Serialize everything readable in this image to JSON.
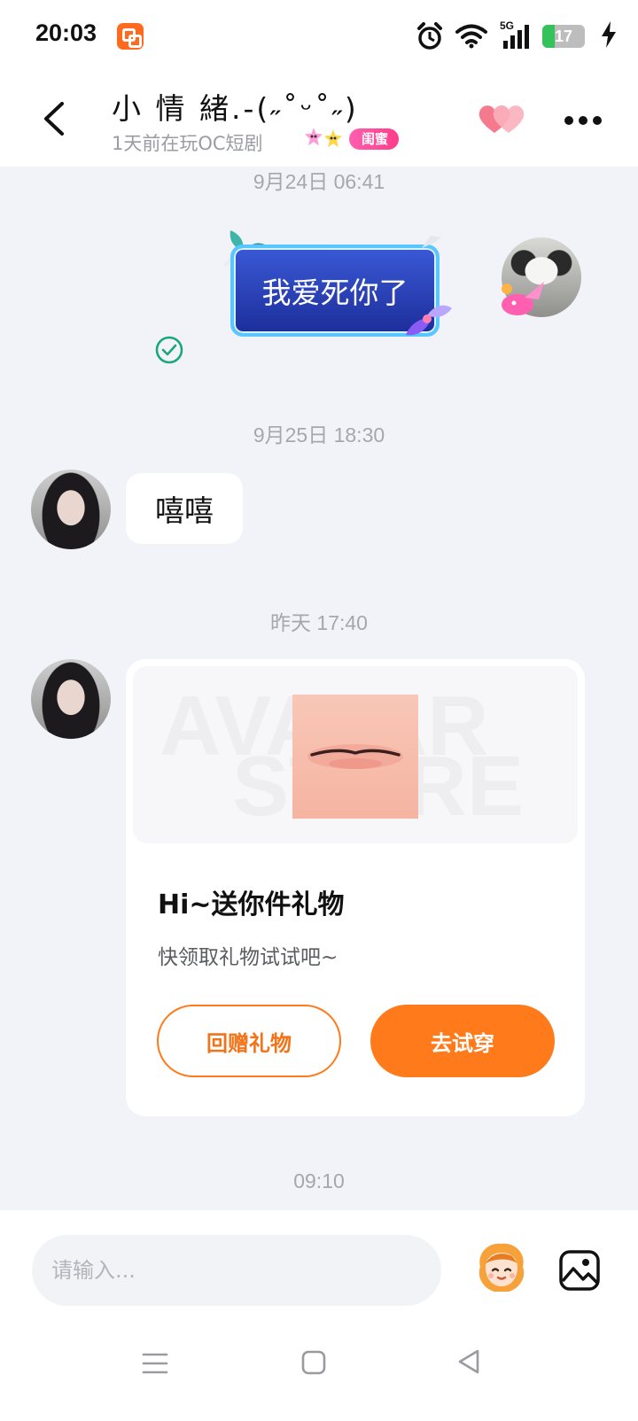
{
  "status_bar": {
    "time": "20:03",
    "network": "5G",
    "battery": "17"
  },
  "header": {
    "contact_name": "小 情 緒.-(˶˚ᵕ˚˶)",
    "contact_status": "1天前在玩OC短剧",
    "relation_badge": "闺蜜"
  },
  "chat": {
    "messages": [
      {
        "timestamp": "9月24日 06:41",
        "direction": "sent",
        "text": "我爱死你了",
        "read": true
      },
      {
        "timestamp": "9月25日 18:30",
        "direction": "received",
        "text": "嘻嘻"
      },
      {
        "timestamp": "昨天 17:40",
        "direction": "received",
        "type": "gift-card"
      }
    ],
    "gift_card": {
      "watermark_line1": "AVATAR",
      "watermark_line2": "STORE",
      "title": "Hi~送你件礼物",
      "description": "快领取礼物试试吧~",
      "return_gift_label": "回赠礼物",
      "try_on_label": "去试穿"
    },
    "last_timestamp": "09:10"
  },
  "input": {
    "placeholder": "请输入..."
  },
  "colors": {
    "accent_orange": "#ff7a1a",
    "badge_pink": "#ff4d9a",
    "read_check_green": "#1aa77a",
    "sent_bubble_blue": "#2b44c2"
  }
}
